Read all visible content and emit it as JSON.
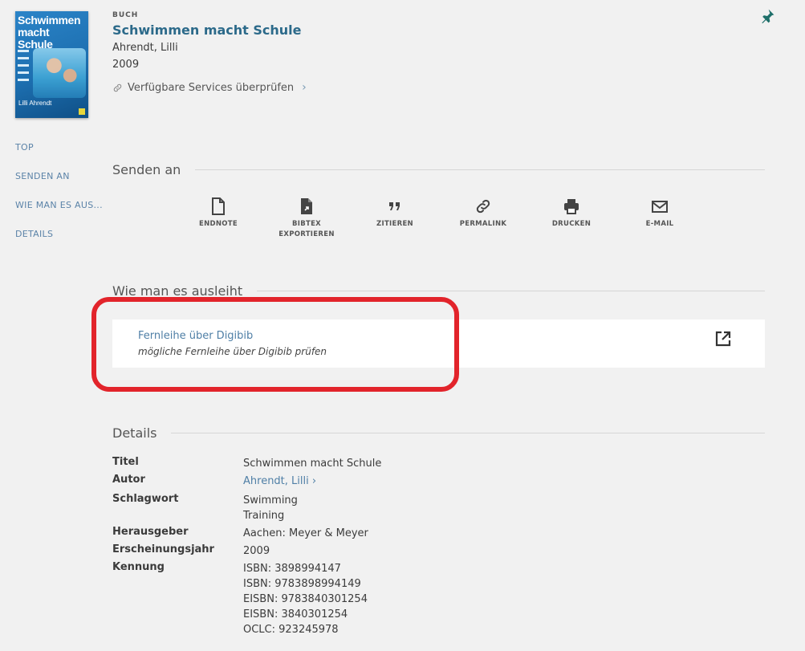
{
  "record": {
    "cover_title": "Schwimmen macht Schule",
    "cover_author": "Lilli Ahrendt",
    "type": "BUCH",
    "title": "Schwimmen macht Schule",
    "author": "Ahrendt, Lilli",
    "year": "2009",
    "services_link": "Verfügbare Services überprüfen"
  },
  "side_nav": [
    "TOP",
    "SENDEN AN",
    "WIE MAN ES AUS...",
    "DETAILS"
  ],
  "send_to": {
    "heading": "Senden an",
    "actions": [
      {
        "label": "ENDNOTE",
        "label2": "",
        "icon": "file-icon"
      },
      {
        "label": "BIBTEX",
        "label2": "EXPORTIEREN",
        "icon": "file-export-icon"
      },
      {
        "label": "ZITIEREN",
        "label2": "",
        "icon": "quote-icon"
      },
      {
        "label": "PERMALINK",
        "label2": "",
        "icon": "link-icon"
      },
      {
        "label": "DRUCKEN",
        "label2": "",
        "icon": "printer-icon"
      },
      {
        "label": "E-MAIL",
        "label2": "",
        "icon": "mail-icon"
      }
    ]
  },
  "loan": {
    "heading": "Wie man es ausleiht",
    "link_title": "Fernleihe über Digibib",
    "link_subtitle": "mögliche Fernleihe über Digibib prüfen",
    "highlight_color": "#e2242b"
  },
  "details": {
    "heading": "Details",
    "rows": [
      {
        "label": "Titel",
        "values": [
          "Schwimmen macht Schule"
        ]
      },
      {
        "label": "Autor",
        "values": [
          "Ahrendt, Lilli"
        ]
      },
      {
        "label": "Schlagwort",
        "values": [
          "Swimming",
          "Training"
        ]
      },
      {
        "label": "Herausgeber",
        "values": [
          "Aachen: Meyer & Meyer"
        ]
      },
      {
        "label": "Erscheinungsjahr",
        "values": [
          "2009"
        ]
      },
      {
        "label": "Kennung",
        "values": [
          "ISBN: 3898994147",
          "ISBN: 9783898994149",
          "EISBN: 9783840301254",
          "EISBN: 3840301254",
          "OCLC: 923245978"
        ]
      }
    ]
  },
  "colors": {
    "accent": "#2c6a8a",
    "link": "#4f7fa6",
    "pin": "#1e6f6a"
  }
}
